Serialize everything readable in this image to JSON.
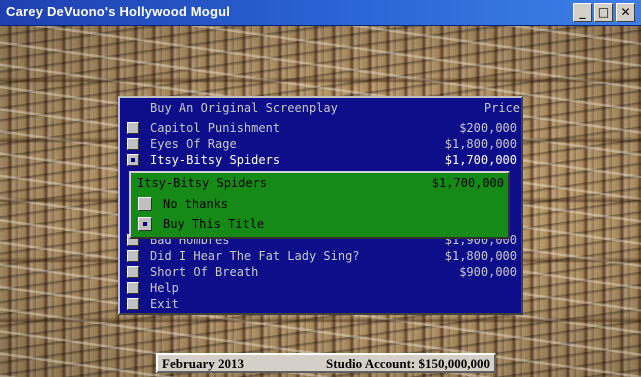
{
  "window": {
    "title": "Carey DeVuono's Hollywood Mogul",
    "minimize": "_",
    "maximize": "□",
    "close": "✕"
  },
  "menu": {
    "header_title": "Buy An Original Screenplay",
    "header_price": "Price",
    "items": [
      {
        "label": "Capitol Punishment",
        "price": "$200,000",
        "selected": false
      },
      {
        "label": "Eyes Of Rage",
        "price": "$1,800,000",
        "selected": false
      },
      {
        "label": "Itsy-Bitsy Spiders",
        "price": "$1,700,000",
        "selected": true
      },
      {
        "label": "Bad Hombres",
        "price": "$1,900,000",
        "selected": false
      },
      {
        "label": "Did I Hear The Fat Lady Sing?",
        "price": "$1,800,000",
        "selected": false
      },
      {
        "label": "Short Of Breath",
        "price": "$900,000",
        "selected": false
      },
      {
        "label": "Help",
        "price": "",
        "selected": false
      },
      {
        "label": "Exit",
        "price": "",
        "selected": false
      }
    ]
  },
  "popup": {
    "title": "Itsy-Bitsy Spiders",
    "price": "$1,700,000",
    "options": [
      {
        "label": "No thanks",
        "selected": false
      },
      {
        "label": "Buy This Title",
        "selected": true
      }
    ]
  },
  "status": {
    "date": "February 2013",
    "account": "Studio Account: $150,000,000"
  },
  "colors": {
    "menu_bg": "#0e0e8a",
    "popup_bg": "#168a16",
    "titlebar": "#2a66d6"
  }
}
